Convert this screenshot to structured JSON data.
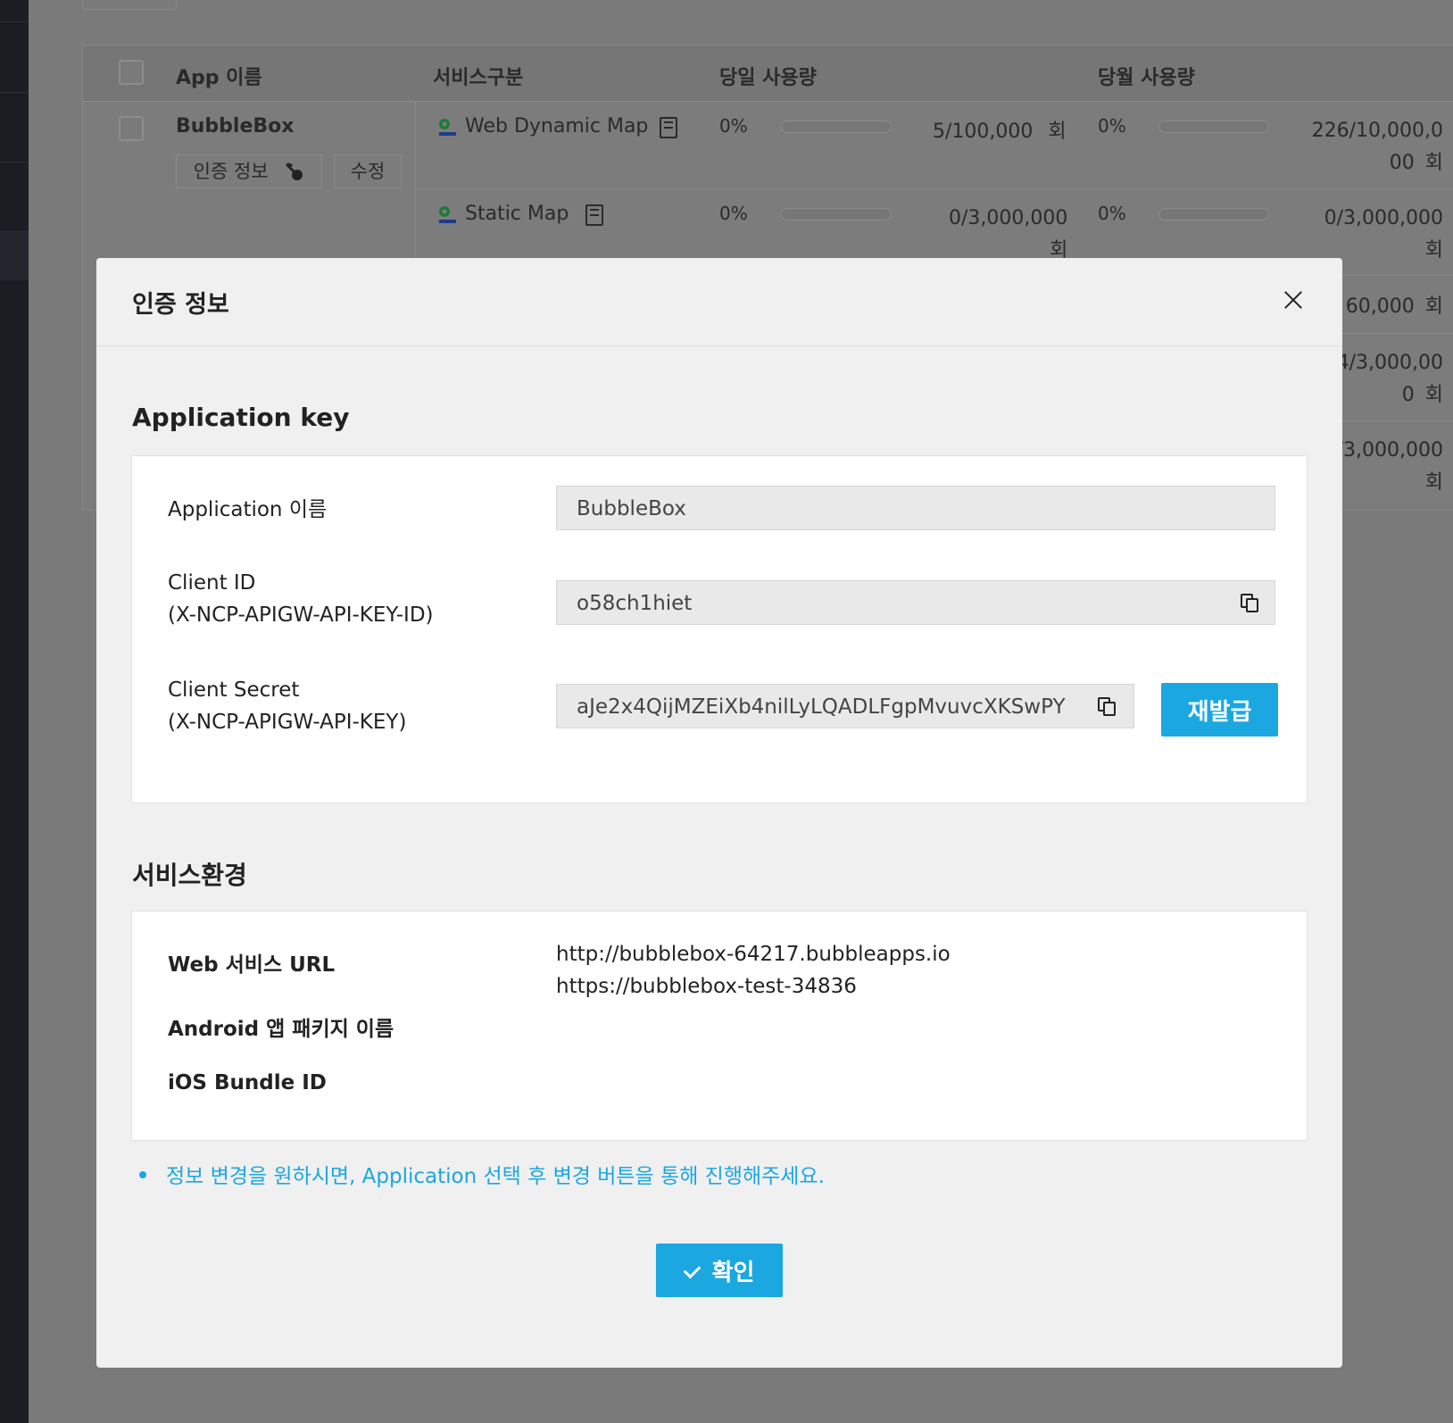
{
  "table": {
    "headers": {
      "app_name": "App 이름",
      "service_type": "서비스구분",
      "daily_usage": "당일 사용량",
      "monthly_usage": "당월 사용량"
    },
    "app": {
      "name": "BubbleBox",
      "auth_button": "인증 정보",
      "edit_button": "수정"
    },
    "rows": [
      {
        "service": "Web Dynamic Map",
        "daily_pct": "0%",
        "daily_count": "5/100,000",
        "daily_unit": "회",
        "daily_progress": 0.05,
        "monthly_pct": "0%",
        "monthly_count_line1": "226/10,000,0",
        "monthly_count_line2": "00",
        "monthly_unit": "회",
        "monthly_progress": 0.0
      },
      {
        "service": "Static Map",
        "daily_pct": "0%",
        "daily_count": "0/3,000,000",
        "daily_unit": "회",
        "daily_progress": 0.0,
        "monthly_pct": "0%",
        "monthly_count_line1": "0/3,000,000",
        "monthly_unit": "회",
        "monthly_progress": 0.0
      }
    ],
    "partial_rows": [
      {
        "line1": "60,000",
        "unit": "회"
      },
      {
        "line1": "4/3,000,00",
        "line2": "0",
        "unit": "회"
      },
      {
        "line1": "/3,000,000",
        "unit": "회"
      }
    ]
  },
  "modal": {
    "title": "인증 정보",
    "app_key_section": {
      "title": "Application key",
      "app_name_label": "Application 이름",
      "app_name_value": "BubbleBox",
      "client_id_label_line1": "Client ID",
      "client_id_label_line2": "(X-NCP-APIGW-API-KEY-ID)",
      "client_id_value": "o58ch1hiet",
      "client_secret_label_line1": "Client Secret",
      "client_secret_label_line2": "(X-NCP-APIGW-API-KEY)",
      "client_secret_value": "aJe2x4QijMZEiXb4nilLyLQADLFgpMvuvcXKSwPY",
      "reissue_button": "재발급"
    },
    "service_env_section": {
      "title": "서비스환경",
      "web_url_label": "Web 서비스 URL",
      "web_urls": [
        "http://bubblebox-64217.bubbleapps.io",
        "https://bubblebox-test-34836"
      ],
      "android_label": "Android 앱 패키지 이름",
      "ios_label": "iOS Bundle ID"
    },
    "notice": "정보 변경을 원하시면, Application 선택 후 변경 버튼을 통해 진행해주세요.",
    "confirm_button": "확인"
  },
  "colors": {
    "accent": "#1ba7e0",
    "overlay": "#7a7a7a",
    "modal_bg": "#f0f0f0",
    "sidebar": "#1b1d22"
  },
  "icons": [
    "key-icon",
    "map-marker-icon",
    "document-icon",
    "copy-icon",
    "close-icon",
    "check-icon"
  ]
}
